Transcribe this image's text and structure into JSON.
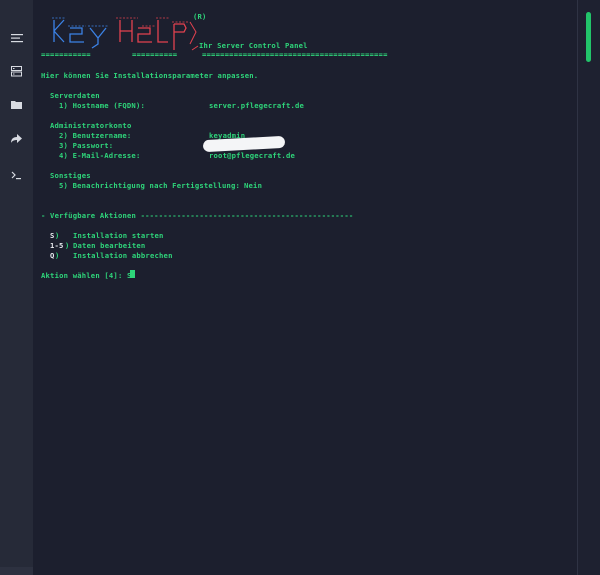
{
  "colors": {
    "accent": "#2ed57a",
    "background": "#1c1f2e",
    "logo_blue": "#3b82e6",
    "logo_red": "#e2424f"
  },
  "titlebar": {
    "icons": [
      "chevron-down-icon",
      "minimize-icon",
      "maximize-icon",
      "close-icon"
    ]
  },
  "sidebar": {
    "items": [
      "menu-icon",
      "server-icon",
      "folder-icon",
      "share-arrow-icon",
      "terminal-icon"
    ]
  },
  "logo": {
    "registered": "(R)",
    "tagline": "Ihr Server Control Panel",
    "rule_left": "===========",
    "rule_mid": "==========",
    "rule_right": "========================================="
  },
  "intro": "Hier können Sie Installationsparameter anpassen.",
  "sections": {
    "server": {
      "title": "Serverdaten",
      "hostname_label": "1) Hostname (FQDN):",
      "hostname_value": "server.pflegecraft.de"
    },
    "admin": {
      "title": "Administratorkonto",
      "username_label": "2) Benutzername:",
      "username_value": "keyadmin",
      "password_label": "3) Passwort:",
      "email_label": "4) E-Mail-Adresse:",
      "email_value": "root@pflegecraft.de"
    },
    "misc": {
      "title": "Sonstiges",
      "notify_label": "5) Benachrichtigung nach Fertigstellung:",
      "notify_value": "Nein"
    }
  },
  "actions": {
    "header": "- Verfügbare Aktionen -----------------------------------------------",
    "items": [
      {
        "key": "S",
        "bracket": ")",
        "label": "Installation starten"
      },
      {
        "key": "1-5",
        "bracket": ")",
        "label": "Daten bearbeiten"
      },
      {
        "key": "Q",
        "bracket": ")",
        "label": "Installation abbrechen"
      }
    ]
  },
  "prompt": "Aktion wählen [4]: S"
}
